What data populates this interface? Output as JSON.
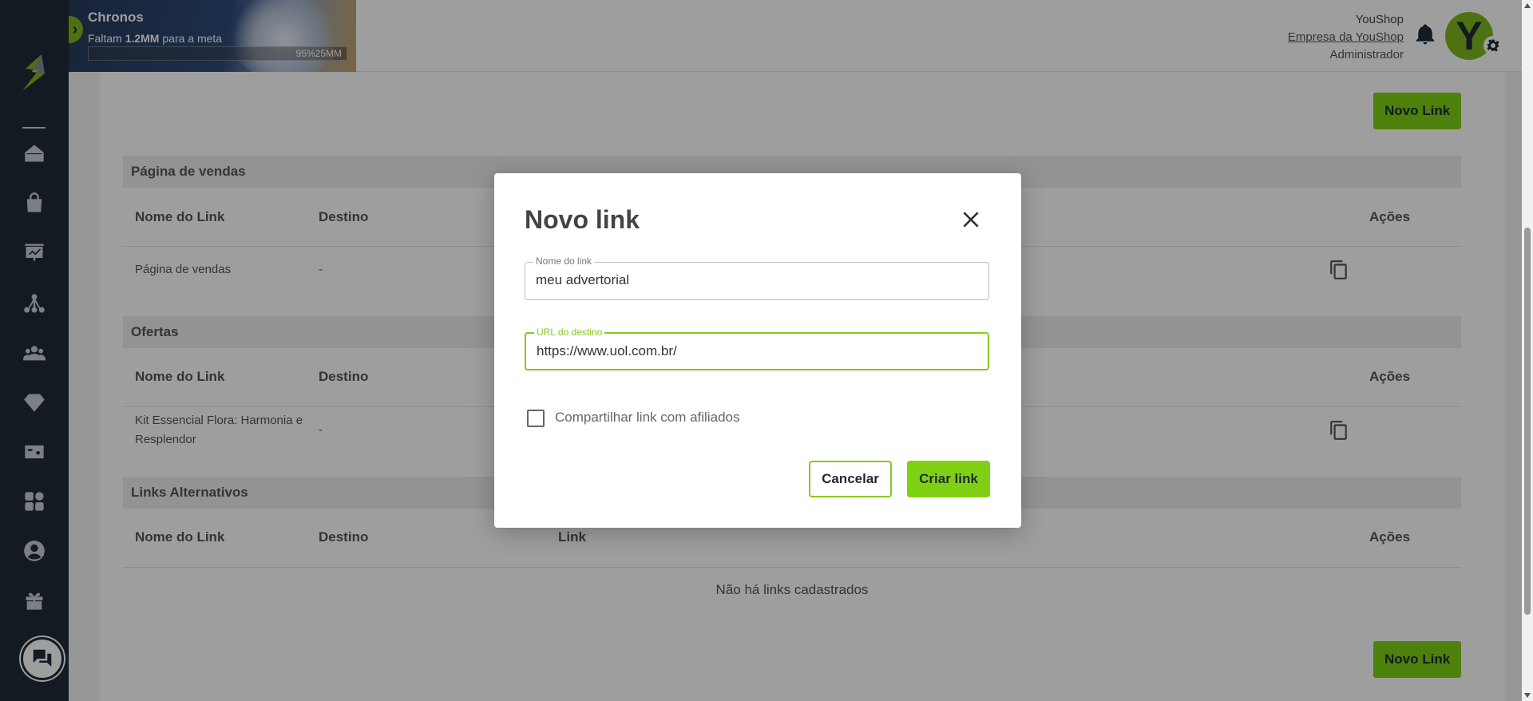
{
  "banner": {
    "title": "Chronos",
    "subtitle_prefix": "Faltam",
    "subtitle_amount": "1.2MM",
    "subtitle_suffix": "para a meta",
    "progress_label": "95%25MM",
    "progress_percent": 95
  },
  "user": {
    "company": "YouShop",
    "company_link": "Empresa da YouShop",
    "role": "Administrador",
    "avatar_letter": "Y"
  },
  "sidebar": {
    "items": [
      "home-icon",
      "shopping-bag-icon",
      "dashboard-icon",
      "network-icon",
      "users-icon",
      "diamond-icon",
      "card-icon",
      "apps-icon",
      "profile-icon",
      "gift-icon"
    ]
  },
  "page": {
    "new_link_button": "Novo Link",
    "sections": [
      {
        "title": "Página de vendas",
        "headers": {
          "name": "Nome do Link",
          "dest": "Destino",
          "actions": "Ações"
        },
        "rows": [
          {
            "name": "Página de vendas",
            "dest": "-"
          }
        ]
      },
      {
        "title": "Ofertas",
        "headers": {
          "name": "Nome do Link",
          "dest": "Destino",
          "actions": "Ações"
        },
        "rows": [
          {
            "name": "Kit Essencial Flora: Harmonia e Resplendor",
            "dest": "-"
          }
        ]
      },
      {
        "title": "Links Alternativos",
        "headers": {
          "name": "Nome do Link",
          "dest": "Destino",
          "link": "Link",
          "actions": "Ações"
        },
        "empty": "Não há links cadastrados"
      }
    ]
  },
  "modal": {
    "title": "Novo link",
    "name_label": "Nome do link",
    "name_value": "meu advertorial",
    "url_label": "URL do destino",
    "url_value": "https://www.uol.com.br/",
    "share_label": "Compartilhar link com afiliados",
    "share_checked": false,
    "cancel": "Cancelar",
    "create": "Criar link"
  }
}
